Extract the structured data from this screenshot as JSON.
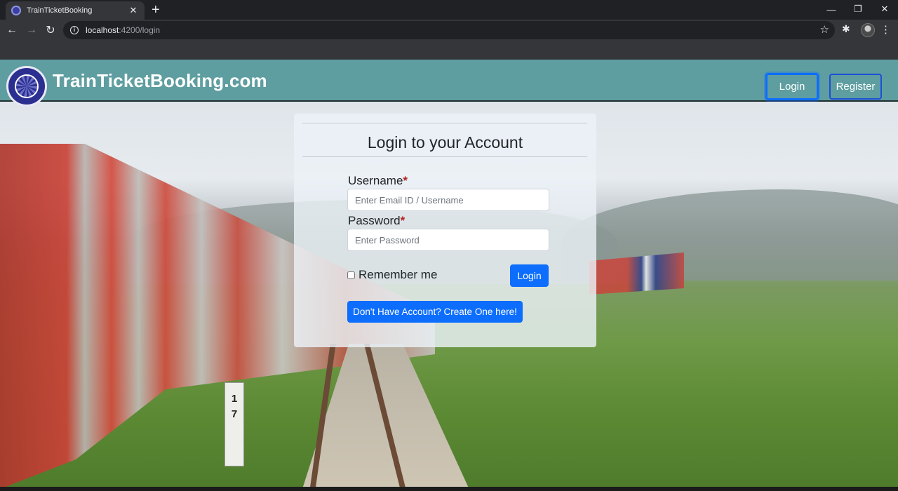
{
  "browser": {
    "tab_title": "TrainTicketBooking",
    "tab_close": "✕",
    "new_tab": "+",
    "url_host": "localhost",
    "url_rest": ":4200/login",
    "icons": [
      "back-icon",
      "forward-icon",
      "reload-icon",
      "info-icon",
      "star-icon",
      "extensions-icon",
      "profile-icon",
      "menu-icon"
    ]
  },
  "navbar": {
    "brand": "TrainTicketBooking.com",
    "login_label": "Login",
    "register_label": "Register",
    "background_color": "#5f9ea0"
  },
  "background": {
    "milestone": "1\n7"
  },
  "login_card": {
    "title": "Login to your Account",
    "username_label": "Username",
    "username_placeholder": "Enter Email ID / Username",
    "password_label": "Password",
    "password_placeholder": "Enter Password",
    "required_mark": "*",
    "remember_label": "Remember me",
    "login_button": "Login",
    "create_account_button": "Don't Have Account? Create One here!",
    "accent_color": "#0d6efd"
  }
}
